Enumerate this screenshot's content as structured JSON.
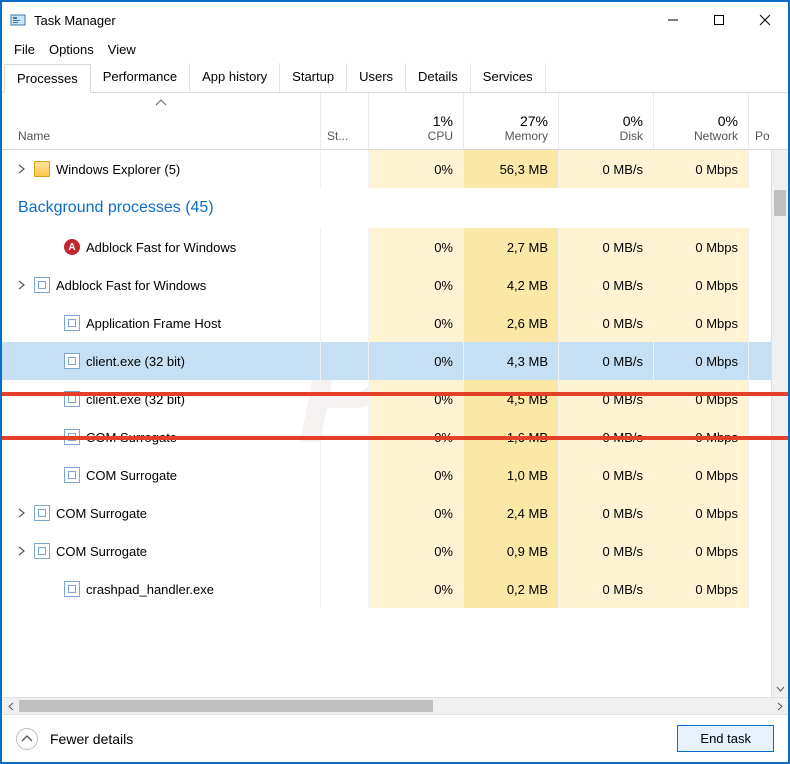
{
  "window": {
    "title": "Task Manager"
  },
  "menubar": {
    "file": "File",
    "options": "Options",
    "view": "View"
  },
  "tabs": [
    "Processes",
    "Performance",
    "App history",
    "Startup",
    "Users",
    "Details",
    "Services"
  ],
  "header": {
    "name": "Name",
    "status_abbrev": "St...",
    "cpu": {
      "pct": "1%",
      "lab": "CPU"
    },
    "memory": {
      "pct": "27%",
      "lab": "Memory"
    },
    "disk": {
      "pct": "0%",
      "lab": "Disk"
    },
    "network": {
      "pct": "0%",
      "lab": "Network"
    },
    "po": "Po"
  },
  "group": {
    "label": "Background processes (45)"
  },
  "rows": [
    {
      "expand": true,
      "icon": "folder",
      "name": "Windows Explorer (5)",
      "cpu": "0%",
      "mem": "56,3 MB",
      "disk": "0 MB/s",
      "net": "0 Mbps",
      "selected": false
    },
    {
      "icon": "adblock",
      "name": "Adblock Fast for Windows",
      "cpu": "0%",
      "mem": "2,7 MB",
      "disk": "0 MB/s",
      "net": "0 Mbps"
    },
    {
      "expand": true,
      "icon": "generic",
      "name": "Adblock Fast for Windows",
      "cpu": "0%",
      "mem": "4,2 MB",
      "disk": "0 MB/s",
      "net": "0 Mbps"
    },
    {
      "icon": "generic",
      "name": "Application Frame Host",
      "cpu": "0%",
      "mem": "2,6 MB",
      "disk": "0 MB/s",
      "net": "0 Mbps"
    },
    {
      "icon": "generic",
      "name": "client.exe (32 bit)",
      "cpu": "0%",
      "mem": "4,3 MB",
      "disk": "0 MB/s",
      "net": "0 Mbps",
      "selected": true
    },
    {
      "icon": "generic",
      "name": "client.exe (32 bit)",
      "cpu": "0%",
      "mem": "4,5 MB",
      "disk": "0 MB/s",
      "net": "0 Mbps"
    },
    {
      "icon": "generic",
      "name": "COM Surrogate",
      "cpu": "0%",
      "mem": "1,6 MB",
      "disk": "0 MB/s",
      "net": "0 Mbps"
    },
    {
      "icon": "generic",
      "name": "COM Surrogate",
      "cpu": "0%",
      "mem": "1,0 MB",
      "disk": "0 MB/s",
      "net": "0 Mbps"
    },
    {
      "expand": true,
      "icon": "generic",
      "name": "COM Surrogate",
      "cpu": "0%",
      "mem": "2,4 MB",
      "disk": "0 MB/s",
      "net": "0 Mbps"
    },
    {
      "expand": true,
      "icon": "generic",
      "name": "COM Surrogate",
      "cpu": "0%",
      "mem": "0,9 MB",
      "disk": "0 MB/s",
      "net": "0 Mbps"
    },
    {
      "icon": "generic",
      "name": "crashpad_handler.exe",
      "cpu": "0%",
      "mem": "0,2 MB",
      "disk": "0 MB/s",
      "net": "0 Mbps"
    }
  ],
  "footer": {
    "fewer": "Fewer details",
    "end": "End task"
  }
}
